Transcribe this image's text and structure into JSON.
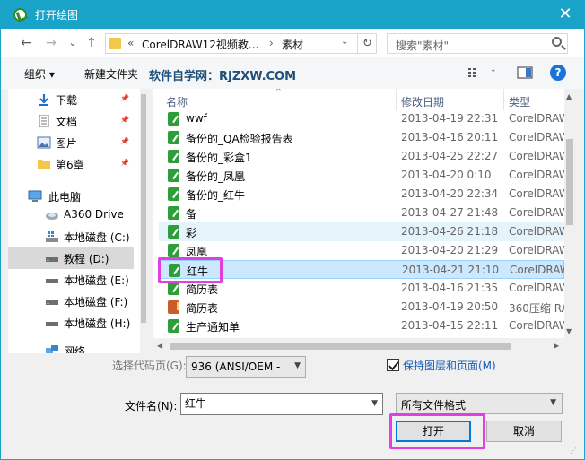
{
  "window": {
    "title": "打开绘图",
    "close_glyph": "✕"
  },
  "nav": {
    "back": "←",
    "forward": "→",
    "dropdown": "⌄",
    "up": "↑",
    "address_overflow": "«",
    "address_parts": [
      "CorelDRAW12视频教...",
      "素材"
    ],
    "address_sep": "›",
    "refresh": "↻",
    "search_placeholder": "搜索\"素材\""
  },
  "toolbar": {
    "organize": "组织 ▾",
    "new_folder": "新建文件夹",
    "site_text": "软件自学网：RJZXW.COM",
    "help": "?"
  },
  "sidebar": {
    "items": [
      {
        "label": "下载",
        "icon": "download-icon",
        "pinned": true
      },
      {
        "label": "文档",
        "icon": "document-icon",
        "pinned": true
      },
      {
        "label": "图片",
        "icon": "pictures-icon",
        "pinned": true
      },
      {
        "label": "第6章",
        "icon": "folder-icon",
        "pinned": true
      },
      {
        "label": "此电脑",
        "icon": "computer-icon",
        "pinned": false
      },
      {
        "label": "A360 Drive",
        "icon": "cloud-drive-icon",
        "pinned": false
      },
      {
        "label": "本地磁盘 (C:)",
        "icon": "windows-drive-icon",
        "pinned": false
      },
      {
        "label": "教程 (D:)",
        "icon": "drive-icon",
        "pinned": false
      },
      {
        "label": "本地磁盘 (E:)",
        "icon": "drive-icon",
        "pinned": false
      },
      {
        "label": "本地磁盘 (F:)",
        "icon": "drive-icon",
        "pinned": false
      },
      {
        "label": "本地磁盘 (H:)",
        "icon": "drive-icon",
        "pinned": false
      },
      {
        "label": "网络",
        "icon": "network-icon",
        "pinned": false
      }
    ],
    "selected_index": 7
  },
  "filelist": {
    "columns": {
      "name": "名称",
      "date": "修改日期",
      "type": "类型"
    },
    "rows": [
      {
        "name": "wwf",
        "date": "2013-04-19 22:31",
        "type": "CorelDRAW"
      },
      {
        "name": "备份的_QA检验报告表",
        "date": "2013-04-16 20:11",
        "type": "CorelDRAW"
      },
      {
        "name": "备份的_彩盒1",
        "date": "2013-04-25 22:27",
        "type": "CorelDRAW"
      },
      {
        "name": "备份的_凤凰",
        "date": "2013-04-20 0:10",
        "type": "CorelDRAW"
      },
      {
        "name": "备份的_红牛",
        "date": "2013-04-20 22:34",
        "type": "CorelDRAW"
      },
      {
        "name": "备",
        "date": "2013-04-27 21:48",
        "type": "CorelDRAW"
      },
      {
        "name": "彩",
        "date": "2013-04-26 21:18",
        "type": "CorelDRAW"
      },
      {
        "name": "凤凰",
        "date": "2013-04-20 21:29",
        "type": "CorelDRAW"
      },
      {
        "name": "红牛",
        "date": "2013-04-21 21:10",
        "type": "CorelDRAW"
      },
      {
        "name": "简历表",
        "date": "2013-04-16 21:35",
        "type": "CorelDRAW"
      },
      {
        "name": "简历表",
        "date": "2013-04-19 20:50",
        "type": "360压缩 RA"
      },
      {
        "name": "生产通知单",
        "date": "2013-04-15 22:11",
        "type": "CorelDRAW"
      }
    ],
    "selected_index": 8,
    "hover_index": 6
  },
  "bottom": {
    "encoding_label": "选择代码页(G):",
    "encoding_value": "936  (ANSI/OEM -",
    "keep_layers_label": "保持图层和页面(M)",
    "filename_label": "文件名(N):",
    "filename_value": "红牛",
    "filetype_value": "所有文件格式",
    "open_button": "打开",
    "cancel_button": "取消"
  },
  "colors": {
    "titlebar": "#1aa3c9",
    "highlight": "#e040e0",
    "selected_row": "#cce8ff"
  }
}
